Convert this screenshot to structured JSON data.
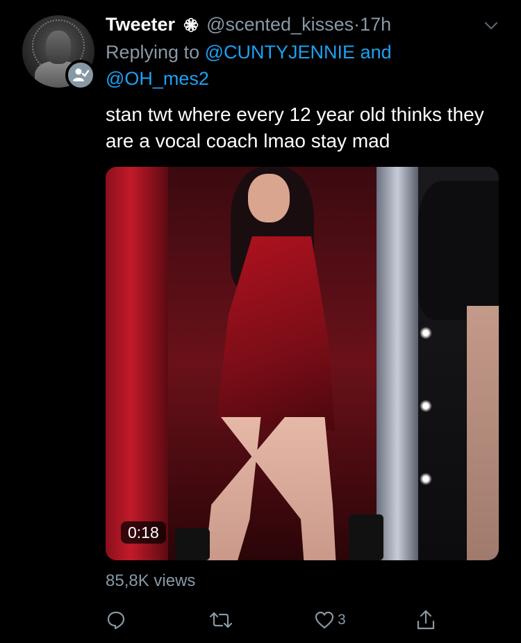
{
  "tweet": {
    "display_name": "Tweeter",
    "separator_icon": "flower-badge-icon",
    "handle": "@scented_kisses",
    "dot": "·",
    "time": "17h",
    "replying_prefix": "Replying to",
    "reply_to_1": "@CUNTYJENNIE",
    "reply_joiner": "and",
    "reply_to_2": "@OH_mes2",
    "text": "stan twt where every 12 year old thinks they are a vocal coach lmao stay mad",
    "media": {
      "type": "video",
      "duration": "0:18"
    },
    "views": "85,8K views",
    "actions": {
      "reply_icon": "reply-icon",
      "retweet_icon": "retweet-icon",
      "like_icon": "heart-icon",
      "like_count": "3",
      "share_icon": "share-icon"
    }
  },
  "colors": {
    "background": "#000000",
    "text": "#ffffff",
    "muted": "#8899a6",
    "link": "#1da1f2"
  }
}
